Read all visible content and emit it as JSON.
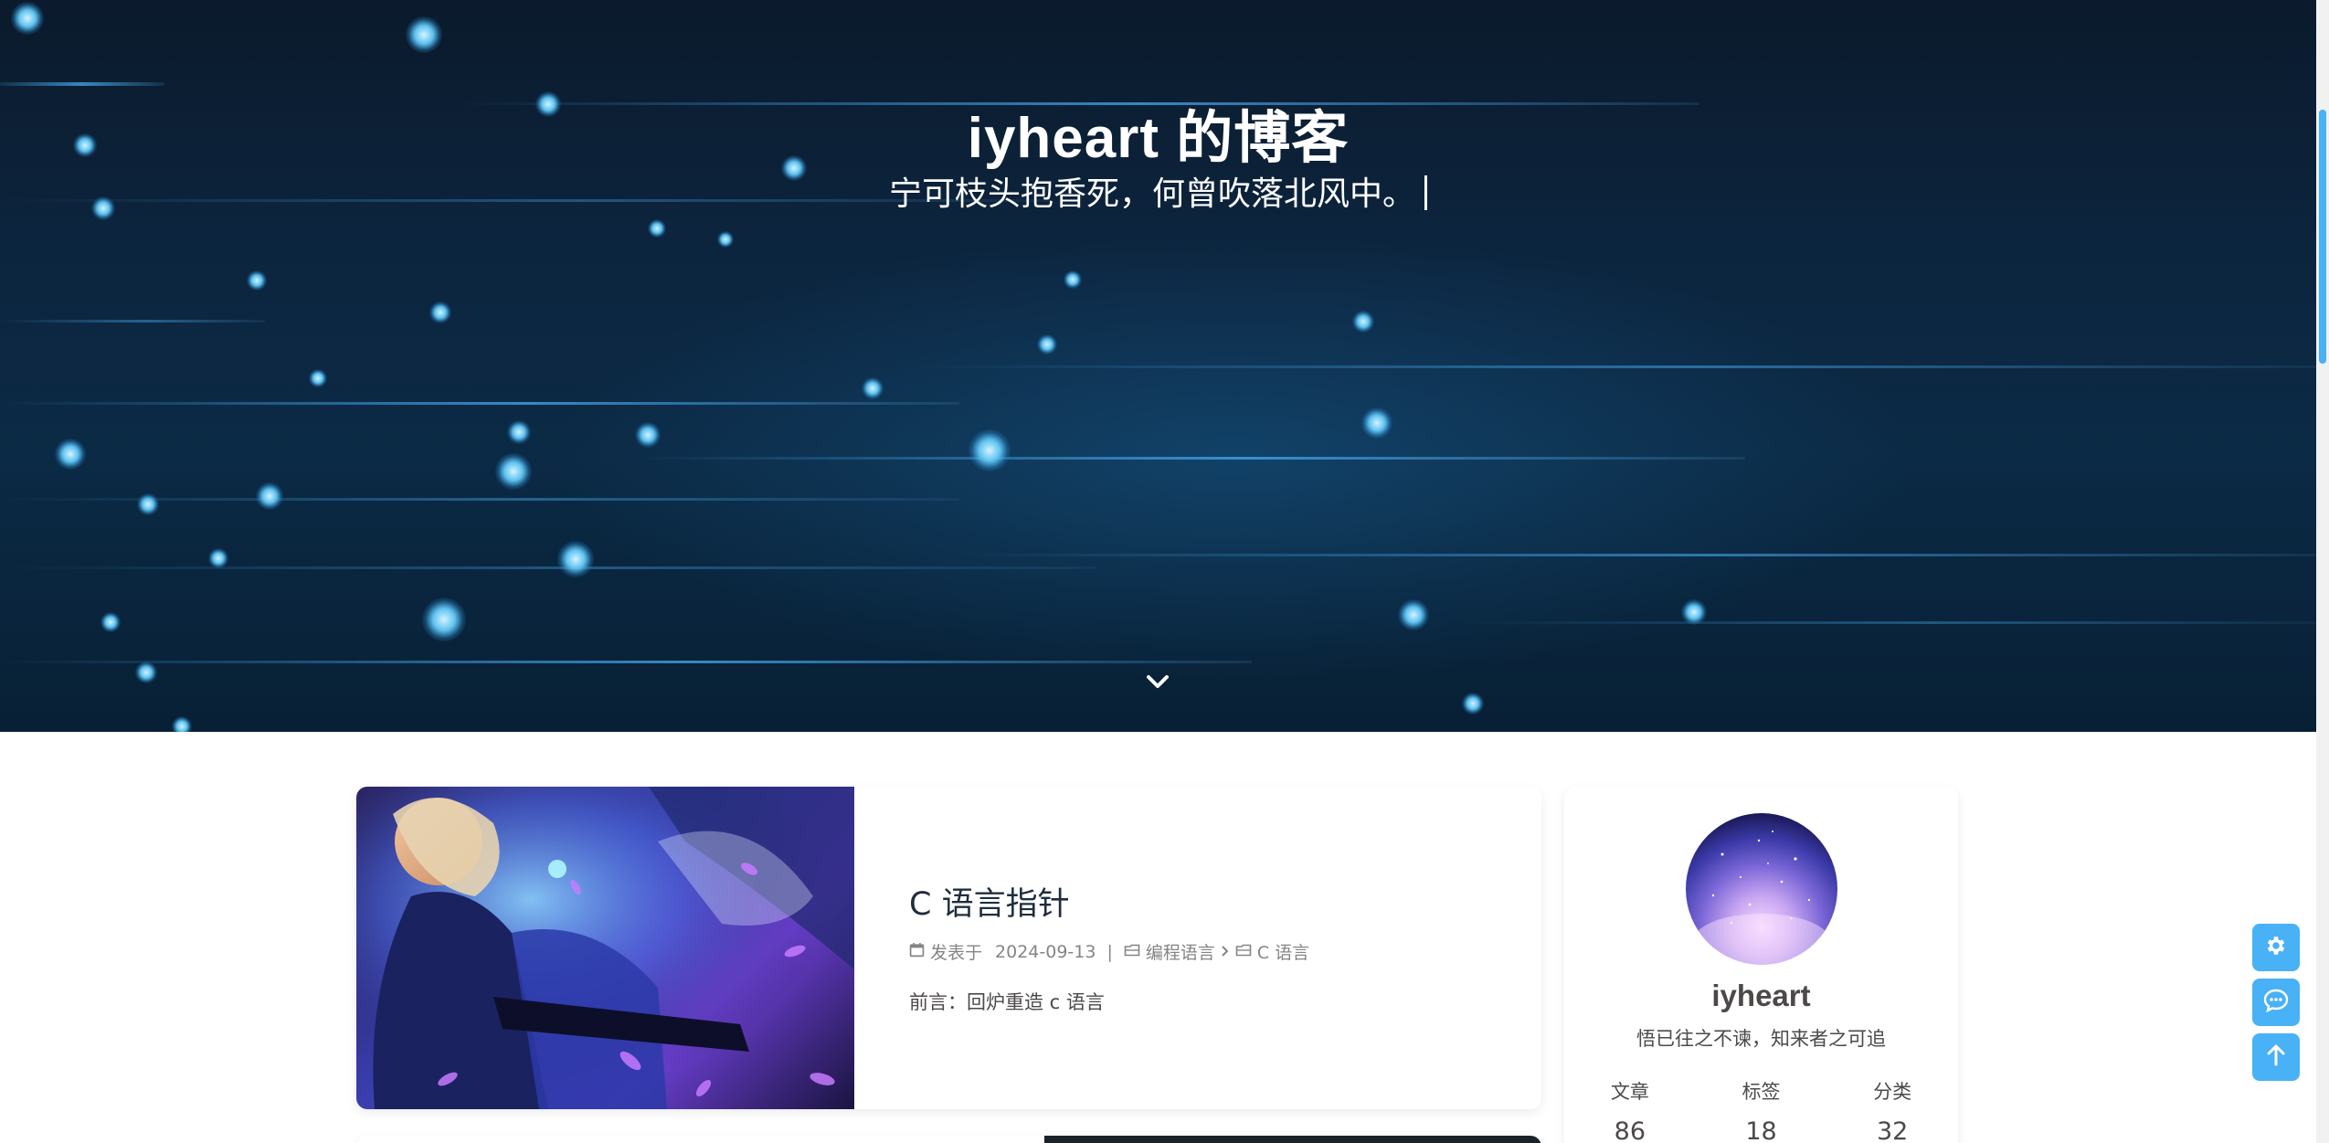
{
  "hero": {
    "title": "iyheart 的博客",
    "subtitle": "宁可枝头抱香死，何曾吹落北风中。",
    "scroll_icon": "chevron-down-icon"
  },
  "posts": [
    {
      "title": "C 语言指针",
      "meta_prefix": "发表于",
      "date": "2024-09-13",
      "category_parent": "编程语言",
      "category_child": "C 语言",
      "excerpt": "前言：回炉重造 c 语言"
    }
  ],
  "profile": {
    "name": "iyheart",
    "description": "悟已往之不谏，知来者之可追",
    "stats": [
      {
        "label": "文章",
        "value": "86"
      },
      {
        "label": "标签",
        "value": "18"
      },
      {
        "label": "分类",
        "value": "32"
      }
    ]
  },
  "floating_buttons": [
    {
      "icon": "gear-icon"
    },
    {
      "icon": "comment-icon"
    },
    {
      "icon": "arrow-up-icon"
    }
  ],
  "colors": {
    "accent": "#49b1f5",
    "hero_bg": "#0c2640",
    "text": "#4c4948",
    "meta": "#858585"
  }
}
